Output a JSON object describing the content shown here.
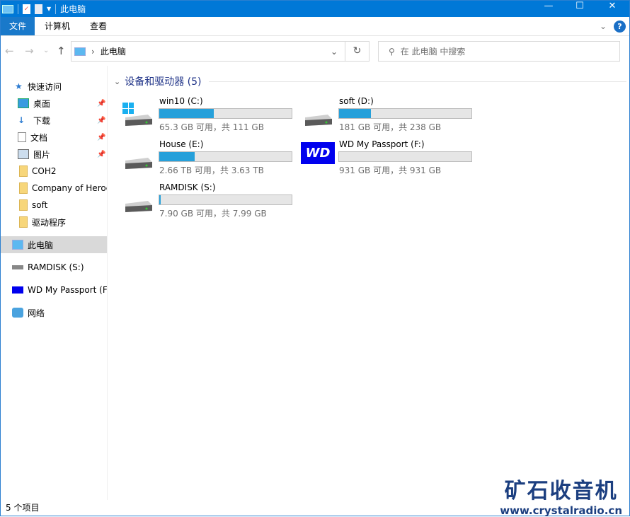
{
  "window": {
    "title": "此电脑"
  },
  "ribbon": {
    "tabs": [
      "文件",
      "计算机",
      "查看"
    ]
  },
  "address": {
    "path": "此电脑",
    "search_placeholder": "在 此电脑 中搜索"
  },
  "nav": {
    "quick_access": "快速访问",
    "pinned": [
      {
        "label": "桌面"
      },
      {
        "label": "下载"
      },
      {
        "label": "文档"
      },
      {
        "label": "图片"
      }
    ],
    "folders": [
      {
        "label": "COH2"
      },
      {
        "label": "Company of Heroes"
      },
      {
        "label": "soft"
      },
      {
        "label": "驱动程序"
      }
    ],
    "this_pc": "此电脑",
    "ramdisk": "RAMDISK (S:)",
    "wd": "WD My Passport (F:)",
    "network": "网络"
  },
  "content": {
    "group_label": "设备和驱动器 (5)",
    "drives": [
      {
        "name": "win10 (C:)",
        "info": "65.3 GB 可用，共 111 GB",
        "used_fraction": 0.41
      },
      {
        "name": "soft (D:)",
        "info": "181 GB 可用，共 238 GB",
        "used_fraction": 0.24
      },
      {
        "name": "House (E:)",
        "info": "2.66 TB 可用，共 3.63 TB",
        "used_fraction": 0.27
      },
      {
        "name": "WD My Passport (F:)",
        "info": "931 GB 可用，共 931 GB",
        "used_fraction": 0.0,
        "logo": "WD"
      },
      {
        "name": "RAMDISK (S:)",
        "info": "7.90 GB 可用，共 7.99 GB",
        "used_fraction": 0.01
      }
    ]
  },
  "status": {
    "count": "5 个项目"
  },
  "watermark": {
    "title": "矿石收音机",
    "url": "www.crystalradio.cn"
  },
  "colors": {
    "accent": "#0078d7",
    "bar_fill": "#26a0da"
  }
}
